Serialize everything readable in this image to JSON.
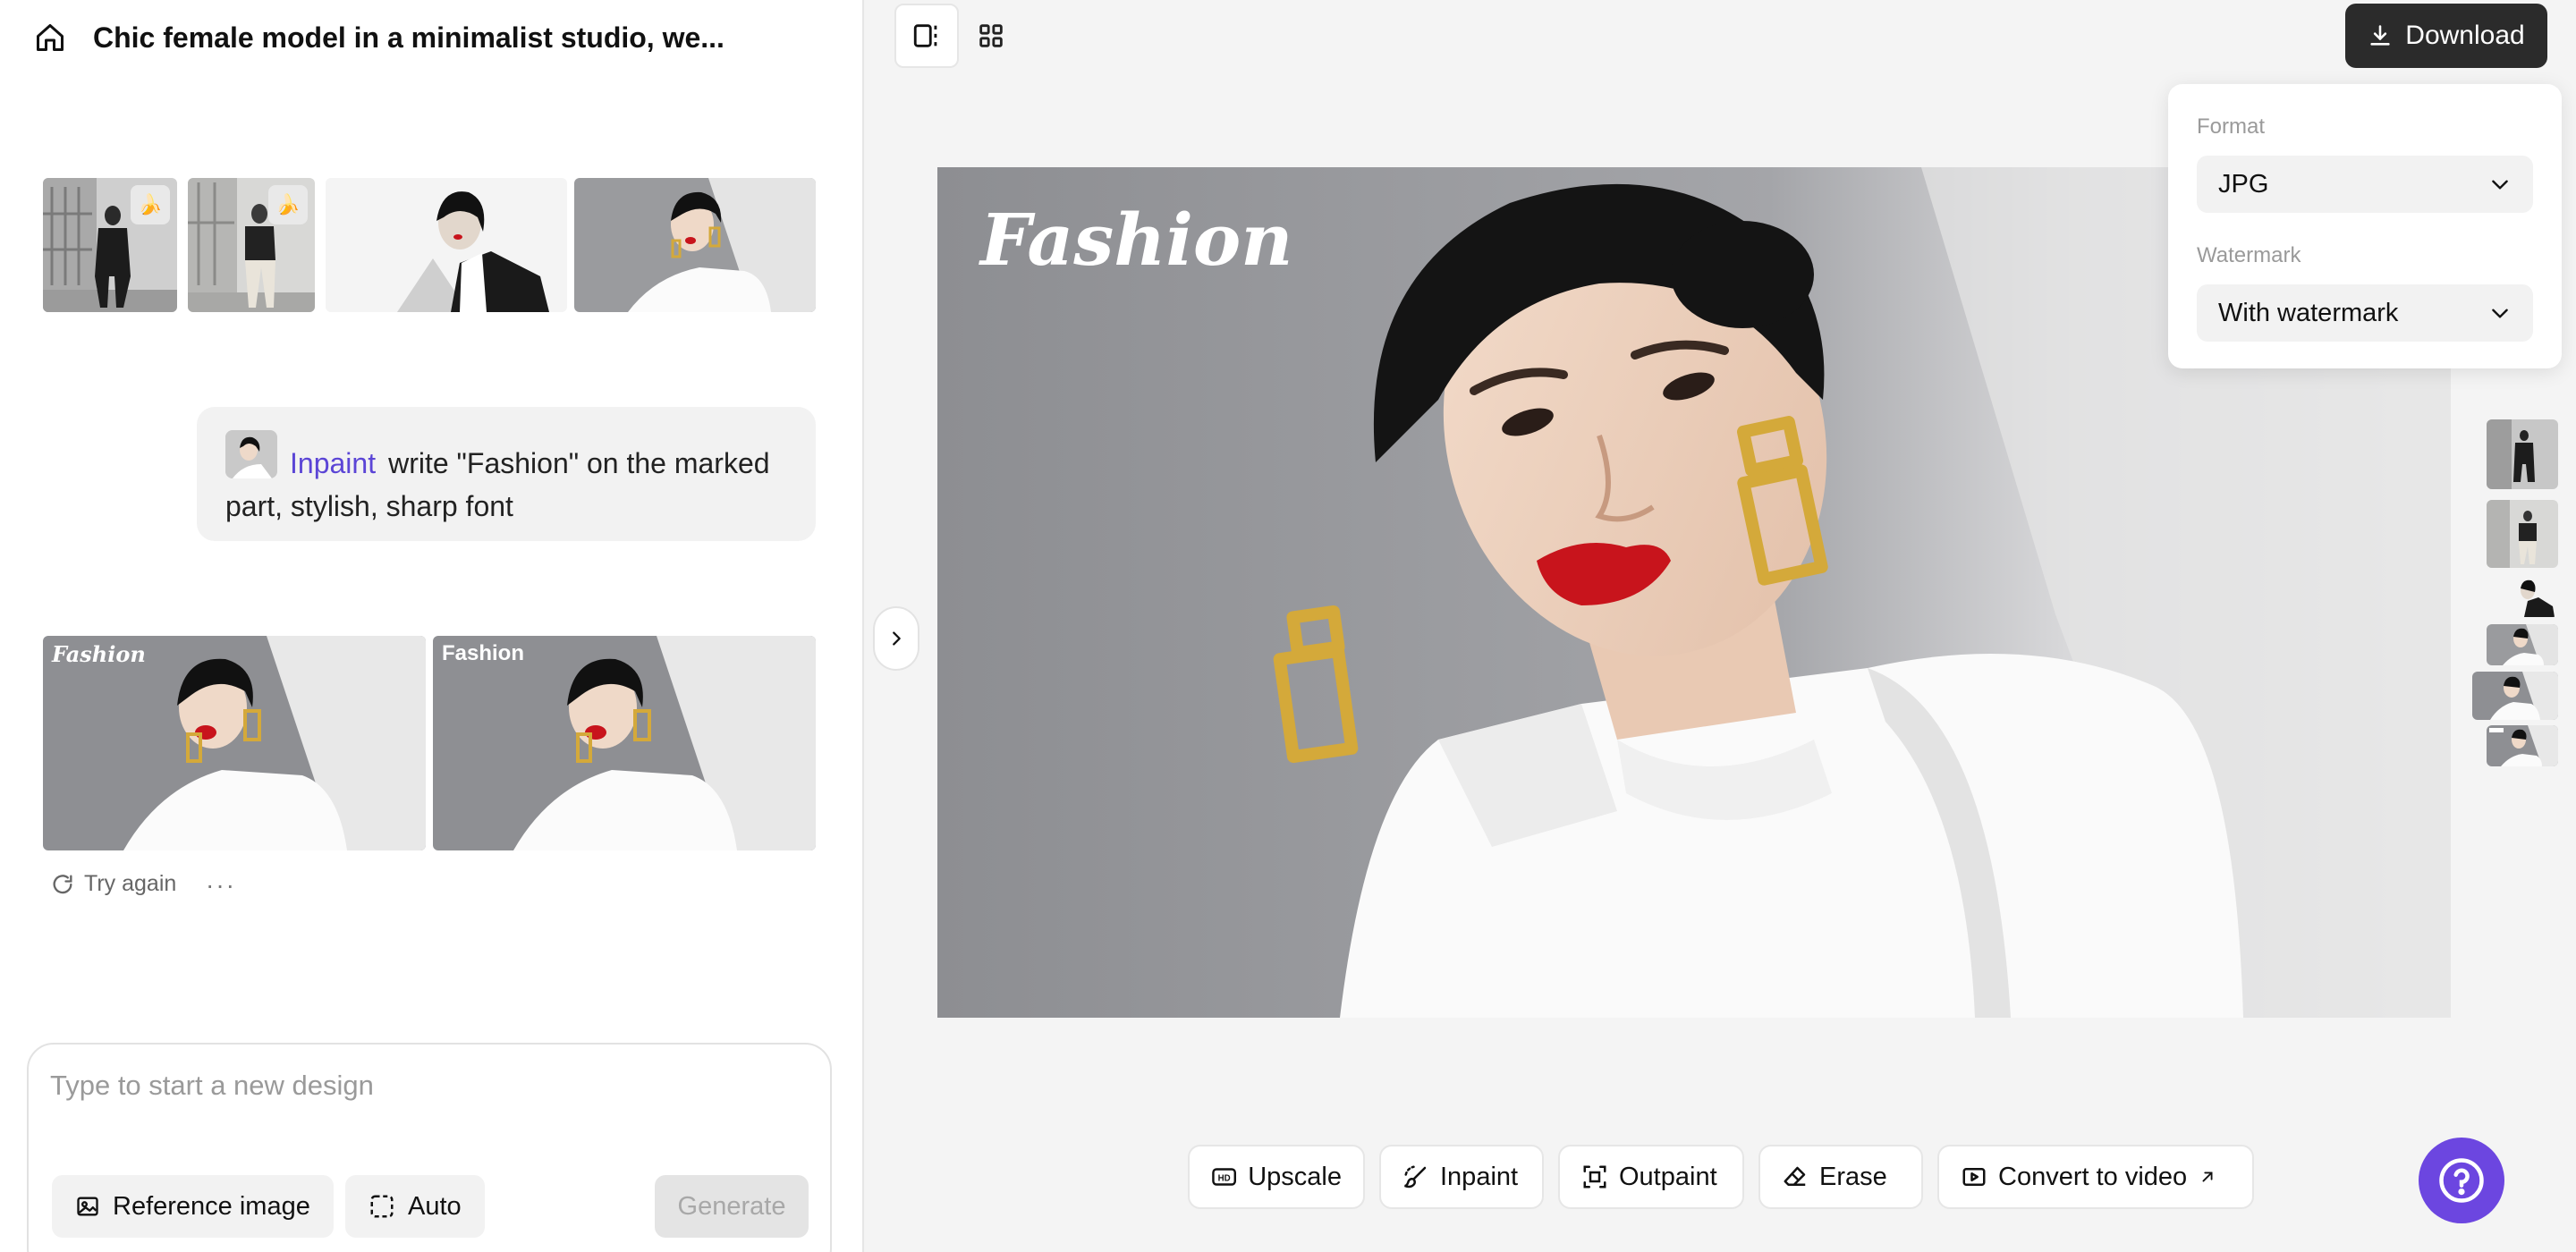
{
  "header": {
    "title": "Chic female model in a minimalist studio, we..."
  },
  "chat": {
    "prompt_tag": "Inpaint",
    "prompt_text": "write \"Fashion\" on the marked part, stylish, sharp font",
    "result_labels": [
      "Fashion",
      "Fashion"
    ],
    "try_again": "Try again",
    "more": "···"
  },
  "composer": {
    "placeholder": "Type to start a new design",
    "reference_label": "Reference image",
    "auto_label": "Auto",
    "generate_label": "Generate"
  },
  "download": {
    "button_label": "Download",
    "format_label": "Format",
    "format_value": "JPG",
    "watermark_label": "Watermark",
    "watermark_value": "With watermark"
  },
  "canvas": {
    "overlay_text": "Fashion"
  },
  "toolbar": {
    "upscale": "Upscale",
    "inpaint": "Inpaint",
    "outpaint": "Outpaint",
    "erase": "Erase",
    "convert": "Convert to video"
  },
  "colors": {
    "accent": "#5b45d6",
    "help_button": "#6c46e0",
    "download_button": "#2b2b2b",
    "lipstick": "#c8141c",
    "gold": "#d4a93a"
  },
  "icons": [
    "home-icon",
    "split-view-icon",
    "grid-view-icon",
    "download-icon",
    "chevron-down-icon",
    "chevron-right-icon",
    "refresh-icon",
    "image-icon",
    "auto-icon",
    "hd-icon",
    "inpaint-brush-icon",
    "outpaint-icon",
    "eraser-icon",
    "video-icon",
    "external-arrow-icon",
    "help-icon",
    "banana-icon"
  ]
}
